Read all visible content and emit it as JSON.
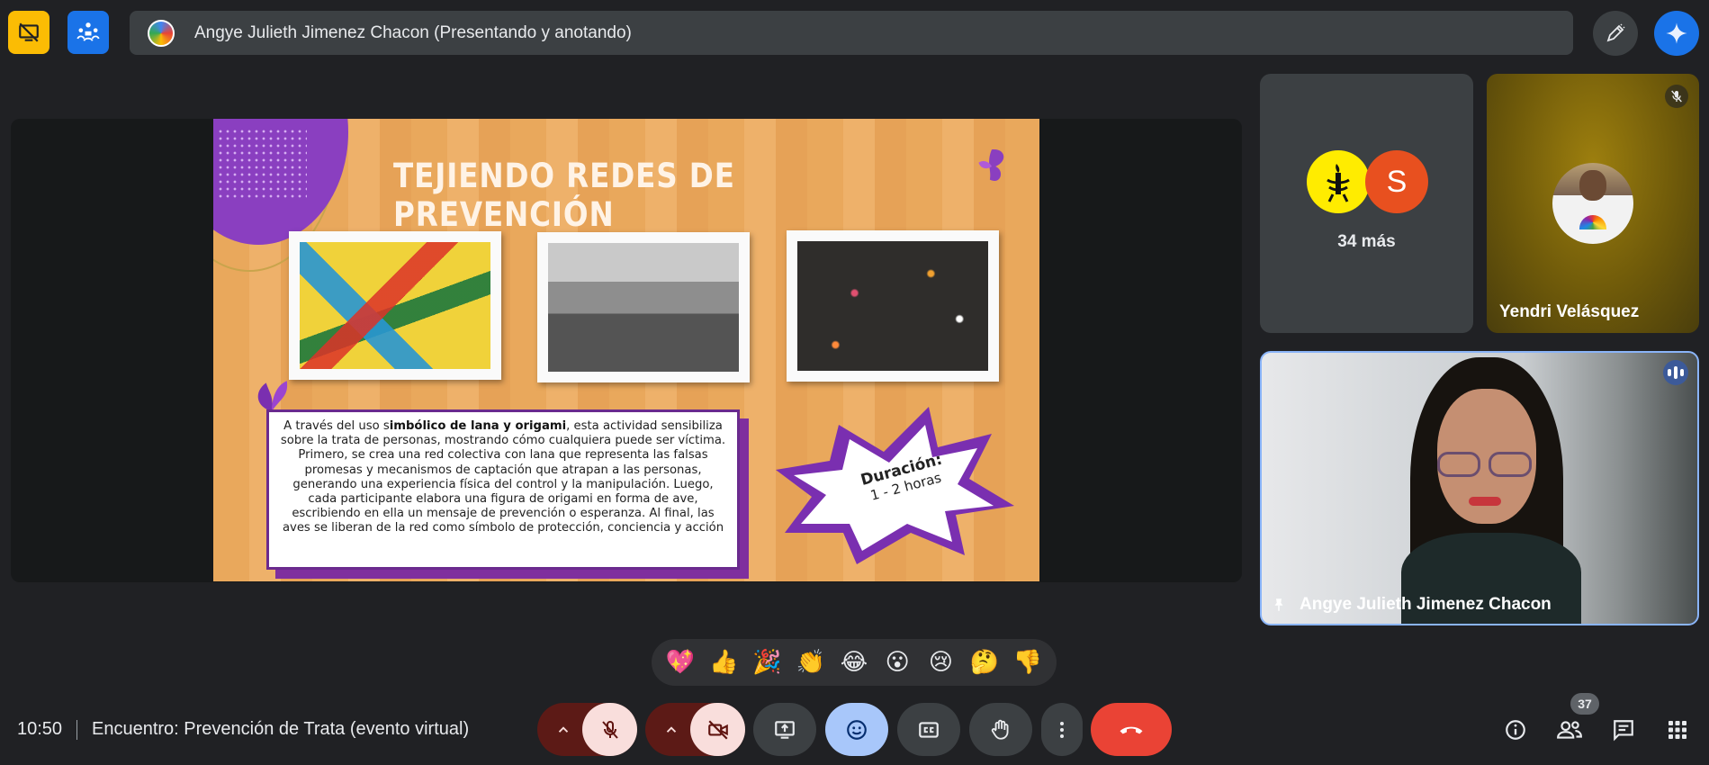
{
  "top_bar": {
    "presenting_label": "Angye Julieth Jimenez Chacon (Presentando y anotando)",
    "colors": {
      "hide_tile_btn": "#fbbc04",
      "layout_btn": "#1a73e8"
    }
  },
  "slide": {
    "title": "TEJIENDO REDES DE PREVENCIÓN",
    "body_prefix": "A través del uso s",
    "body_bold": "imbólico de lana y origami",
    "body_rest": ", esta actividad sensibiliza sobre la trata de personas, mostrando cómo cualquiera puede ser víctima. Primero, se crea una red colectiva con lana que representa las falsas promesas y mecanismos de captación que atrapan a las personas, generando una experiencia física del control y la manipulación. Luego, cada participante elabora una figura de origami en forma de ave, escribiendo en ella un mensaje de prevención o esperanza. Al final, las aves se liberan de la red como símbolo de protección, conciencia y acción",
    "duration_label": "Duración:",
    "duration_value": "1 - 2 horas"
  },
  "tiles": {
    "others": {
      "avatar_letter": "S",
      "label": "34 más",
      "avatar_color": "#e8501f",
      "logo_color": "#ffec00"
    },
    "yendri": {
      "name": "Yendri Velásquez",
      "muted": true
    },
    "angye": {
      "name": "Angye Julieth Jimenez Chacon",
      "pinned": true,
      "speaking": true
    }
  },
  "reactions": [
    "💖",
    "👍",
    "🎉",
    "👏",
    "😂",
    "😮",
    "😢",
    "🤔",
    "👎"
  ],
  "bottom_bar": {
    "time": "10:50",
    "meeting_title": "Encuentro: Prevención de Trata (evento virtual)",
    "participant_count": "37",
    "colors": {
      "leave": "#ea4335",
      "active_reaction": "#a8c7fa",
      "off_state": "#f9dedc"
    }
  }
}
